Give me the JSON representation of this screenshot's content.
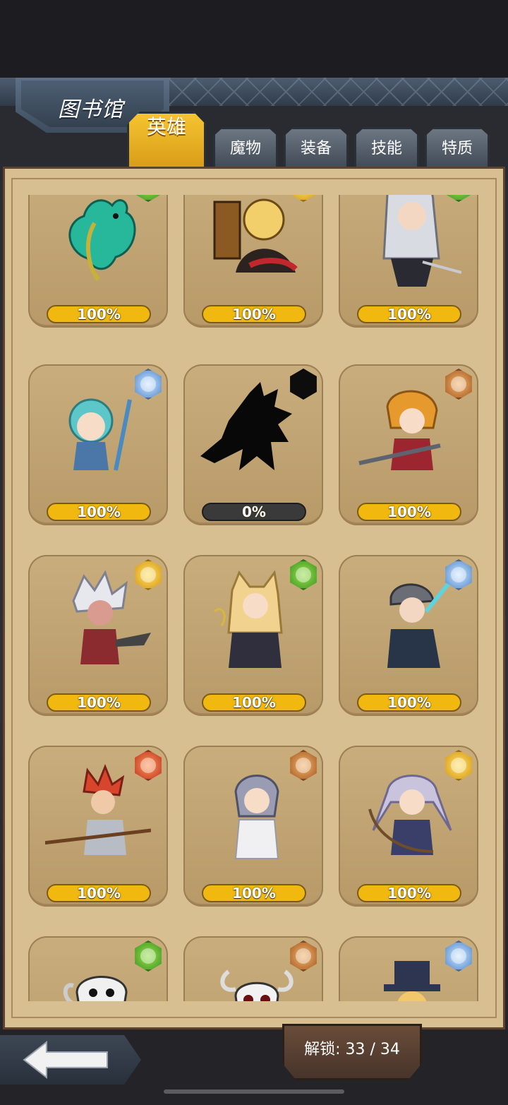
{
  "screen": {
    "title": "图书馆",
    "tabs": [
      {
        "label": "英雄",
        "active": true
      },
      {
        "label": "魔物",
        "active": false
      },
      {
        "label": "装备",
        "active": false
      },
      {
        "label": "技能",
        "active": false
      },
      {
        "label": "特质",
        "active": false
      }
    ]
  },
  "heroes": [
    {
      "progress": "100%",
      "element": "nature-icon",
      "color": "#2f8a1f"
    },
    {
      "progress": "100%",
      "element": "light-icon",
      "color": "#d08b07"
    },
    {
      "progress": "100%",
      "element": "nature-icon",
      "color": "#2f8a1f"
    },
    {
      "progress": "100%",
      "element": "water-icon",
      "color": "#3f78c4"
    },
    {
      "progress": "0%",
      "element": "unknown-icon",
      "color": "#0d0d0d",
      "locked": true
    },
    {
      "progress": "100%",
      "element": "earth-icon",
      "color": "#9a4a14"
    },
    {
      "progress": "100%",
      "element": "light-icon",
      "color": "#d08b07"
    },
    {
      "progress": "100%",
      "element": "nature-icon",
      "color": "#2f8a1f"
    },
    {
      "progress": "100%",
      "element": "water-icon",
      "color": "#3f78c4"
    },
    {
      "progress": "100%",
      "element": "fire-icon",
      "color": "#b5231c"
    },
    {
      "progress": "100%",
      "element": "earth-icon",
      "color": "#9a4a14"
    },
    {
      "progress": "100%",
      "element": "light-icon",
      "color": "#d08b07"
    },
    {
      "progress": "",
      "element": "nature-icon",
      "color": "#2f8a1f"
    },
    {
      "progress": "",
      "element": "earth-icon",
      "color": "#9a4a14"
    },
    {
      "progress": "",
      "element": "water-icon",
      "color": "#3f78c4"
    }
  ],
  "footer": {
    "unlock_text": "解锁: 33 / 34"
  }
}
